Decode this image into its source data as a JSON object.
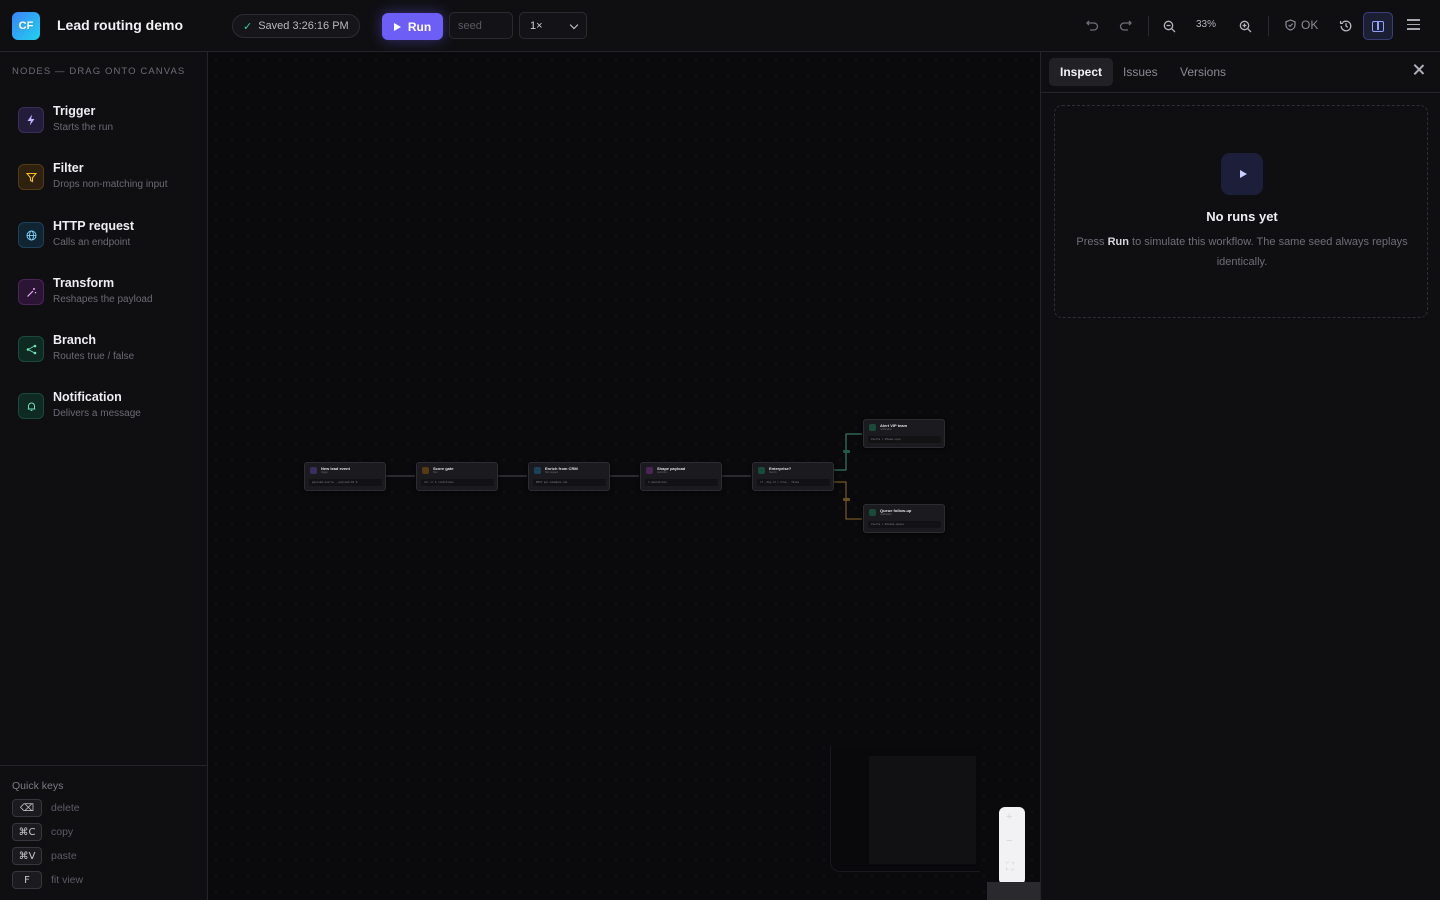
{
  "app": {
    "logo": "CF",
    "title": "Lead routing demo"
  },
  "toolbar": {
    "saved_label": "Saved 3:26:16 PM",
    "run_label": "Run",
    "seed_placeholder": "seed",
    "speed_value": "1×",
    "zoom_value": "33%",
    "status_label": "OK"
  },
  "sidebar": {
    "heading": "NODES — DRAG ONTO CANVAS",
    "items": [
      {
        "name": "Trigger",
        "desc": "Starts the run",
        "icon": "bolt-icon",
        "color": "#a78bfa"
      },
      {
        "name": "Filter",
        "desc": "Drops non-matching input",
        "icon": "filter-icon",
        "color": "#f59e0b"
      },
      {
        "name": "HTTP request",
        "desc": "Calls an endpoint",
        "icon": "globe-icon",
        "color": "#38bdf8"
      },
      {
        "name": "Transform",
        "desc": "Reshapes the payload",
        "icon": "wand-icon",
        "color": "#e879f9"
      },
      {
        "name": "Branch",
        "desc": "Routes true / false",
        "icon": "branch-icon",
        "color": "#34d399"
      },
      {
        "name": "Notification",
        "desc": "Delivers a message",
        "icon": "bell-icon",
        "color": "#34d399"
      }
    ],
    "quick_title": "Quick keys",
    "quick_keys": [
      {
        "key": "⌫",
        "label": "delete"
      },
      {
        "key": "⌘C",
        "label": "copy"
      },
      {
        "key": "⌘V",
        "label": "paste"
      },
      {
        "key": "F",
        "label": "fit view"
      }
    ]
  },
  "canvas": {
    "nodes": [
      {
        "title": "New lead event",
        "sub": "trigger",
        "code": "payload.source , payload.ID 0",
        "color": "#a78bfa"
      },
      {
        "title": "Score gate",
        "sub": "filter",
        "code": "dic >= 5 conditions",
        "color": "#f59e0b"
      },
      {
        "title": "Enrich from CRM",
        "sub": "http request",
        "code": "POST api.example.com",
        "color": "#38bdf8"
      },
      {
        "title": "Shape payload",
        "sub": "transform",
        "code": "3 operations",
        "color": "#e879f9"
      },
      {
        "title": "Enterprise?",
        "sub": "branch",
        "code": "if .dig.id > true , false",
        "color": "#34d399"
      },
      {
        "title": "Alert VIP team",
        "sub": "notification",
        "code": "Alerts > #team-vips",
        "color": "#34d399"
      },
      {
        "title": "Queue follow-up",
        "sub": "notification",
        "code": "Alerts > #leads-queue",
        "color": "#34d399"
      }
    ]
  },
  "inspector": {
    "tabs": [
      "Inspect",
      "Issues",
      "Versions"
    ],
    "empty_title": "No runs yet",
    "empty_desc_pre": "Press ",
    "empty_desc_bold": "Run",
    "empty_desc_post": " to simulate this workflow. The same seed always replays identically."
  }
}
